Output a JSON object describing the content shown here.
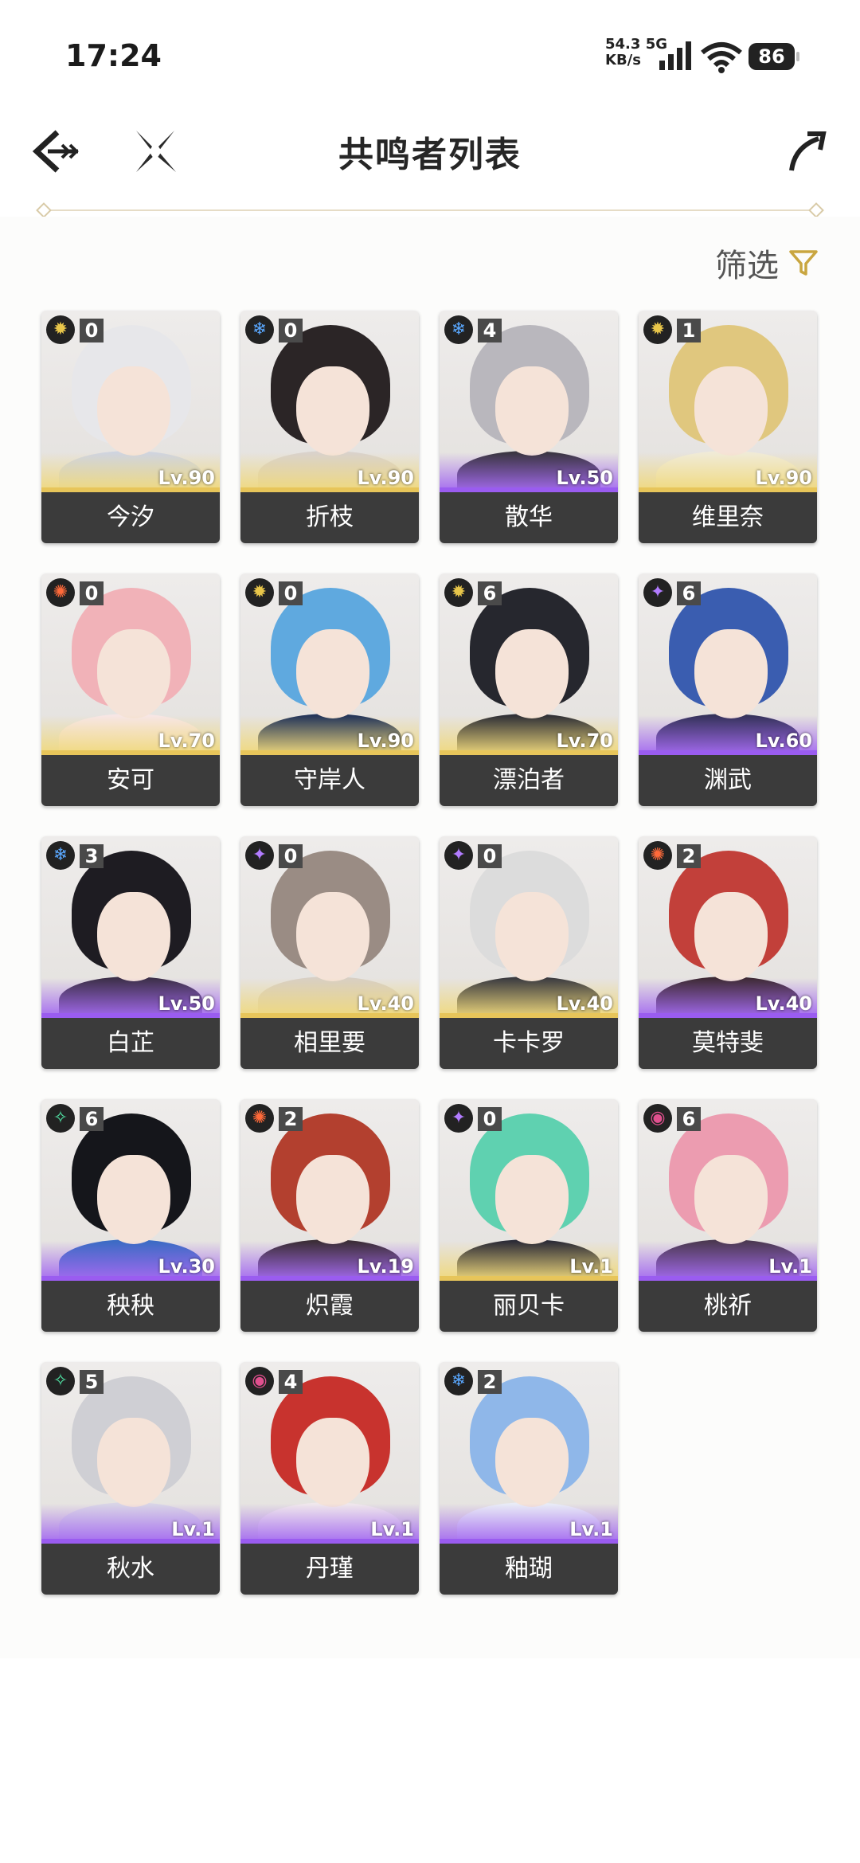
{
  "status": {
    "time": "17:24",
    "speed": "54.3",
    "speed_unit": "KB/s",
    "network": "5G",
    "battery": "86"
  },
  "header": {
    "title": "共鸣者列表"
  },
  "filter": {
    "label": "筛选"
  },
  "colors": {
    "accent": "#c9a640",
    "gold": "#e7c55a",
    "purple": "#9a5cf0"
  },
  "characters": [
    {
      "name": "今汐",
      "level": "Lv.90",
      "constellation": "0",
      "element": "spectro",
      "rarity": "gold",
      "hair": "#e7e7ea",
      "outfit": "#cfd4e0"
    },
    {
      "name": "折枝",
      "level": "Lv.90",
      "constellation": "0",
      "element": "glacio",
      "rarity": "gold",
      "hair": "#2b2526",
      "outfit": "#d9d2cc"
    },
    {
      "name": "散华",
      "level": "Lv.50",
      "constellation": "4",
      "element": "glacio",
      "rarity": "purple",
      "hair": "#b9b7bd",
      "outfit": "#3a3540"
    },
    {
      "name": "维里奈",
      "level": "Lv.90",
      "constellation": "1",
      "element": "spectro",
      "rarity": "gold",
      "hair": "#e0c77e",
      "outfit": "#f0ebd8"
    },
    {
      "name": "安可",
      "level": "Lv.70",
      "constellation": "0",
      "element": "fusion",
      "rarity": "gold",
      "hair": "#f1b2b8",
      "outfit": "#f7e6e6"
    },
    {
      "name": "守岸人",
      "level": "Lv.90",
      "constellation": "0",
      "element": "spectro",
      "rarity": "gold",
      "hair": "#5fa9df",
      "outfit": "#22345a"
    },
    {
      "name": "漂泊者",
      "level": "Lv.70",
      "constellation": "6",
      "element": "spectro",
      "rarity": "gold",
      "hair": "#26272e",
      "outfit": "#2e2f36"
    },
    {
      "name": "渊武",
      "level": "Lv.60",
      "constellation": "6",
      "element": "electro",
      "rarity": "purple",
      "hair": "#3a5db0",
      "outfit": "#34325a"
    },
    {
      "name": "白芷",
      "level": "Lv.50",
      "constellation": "3",
      "element": "glacio",
      "rarity": "purple",
      "hair": "#1e1c22",
      "outfit": "#3c2f48"
    },
    {
      "name": "相里要",
      "level": "Lv.40",
      "constellation": "0",
      "element": "electro",
      "rarity": "gold",
      "hair": "#9a8c84",
      "outfit": "#d8cfc4"
    },
    {
      "name": "卡卡罗",
      "level": "Lv.40",
      "constellation": "0",
      "element": "electro",
      "rarity": "gold",
      "hair": "#dcdcdc",
      "outfit": "#3b3b40"
    },
    {
      "name": "莫特斐",
      "level": "Lv.40",
      "constellation": "2",
      "element": "fusion",
      "rarity": "purple",
      "hair": "#c2403a",
      "outfit": "#3e2a34"
    },
    {
      "name": "秧秧",
      "level": "Lv.30",
      "constellation": "6",
      "element": "aero",
      "rarity": "purple",
      "hair": "#15161b",
      "outfit": "#3b6bc4"
    },
    {
      "name": "炽霞",
      "level": "Lv.19",
      "constellation": "2",
      "element": "fusion",
      "rarity": "purple",
      "hair": "#b3402f",
      "outfit": "#3b2d35"
    },
    {
      "name": "丽贝卡",
      "level": "Lv.1",
      "constellation": "0",
      "element": "electro",
      "rarity": "gold",
      "hair": "#5fd1b0",
      "outfit": "#2a2a36"
    },
    {
      "name": "桃祈",
      "level": "Lv.1",
      "constellation": "6",
      "element": "havoc",
      "rarity": "purple",
      "hair": "#ec9cb0",
      "outfit": "#4b3850"
    },
    {
      "name": "秋水",
      "level": "Lv.1",
      "constellation": "5",
      "element": "aero",
      "rarity": "purple",
      "hair": "#cfcfd4",
      "outfit": "#d9d5e6"
    },
    {
      "name": "丹瑾",
      "level": "Lv.1",
      "constellation": "4",
      "element": "havoc",
      "rarity": "purple",
      "hair": "#c8332e",
      "outfit": "#f0e8ec"
    },
    {
      "name": "釉瑚",
      "level": "Lv.1",
      "constellation": "2",
      "element": "glacio",
      "rarity": "purple",
      "hair": "#8fb7e9",
      "outfit": "#e9ecf6"
    }
  ]
}
